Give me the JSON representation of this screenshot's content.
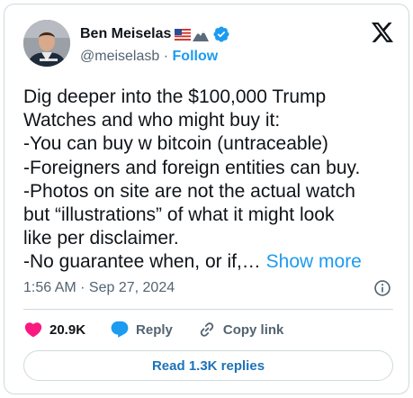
{
  "author": {
    "name": "Ben Meiselas",
    "handle": "@meiselasb",
    "separator": "·",
    "follow_label": "Follow",
    "badge_emojis": [
      "us-flag-emoji",
      "mountain-emoji"
    ],
    "verified": true
  },
  "tweet": {
    "lines": [
      "Dig deeper into the $100,000 Trump",
      "Watches and who might buy it:",
      "-You can buy w bitcoin (untraceable)",
      "-Foreigners and foreign entities can buy.",
      "-Photos on site are not the actual watch",
      "but “illustrations” of what it might look",
      "like per disclaimer.",
      "-No guarantee when, or if,…"
    ],
    "show_more_label": "Show more",
    "timestamp": "1:56 AM · Sep 27, 2024"
  },
  "actions": {
    "likes": "20.9K",
    "reply_label": "Reply",
    "copy_link_label": "Copy link"
  },
  "replies_button_label": "Read 1.3K replies",
  "colors": {
    "accent": "#1d9bf0",
    "like": "#f91880",
    "text": "#0f1419",
    "muted": "#536471",
    "border": "#cfd9de"
  },
  "icons": [
    "avatar-photo",
    "us-flag-emoji",
    "mountain-emoji",
    "verified-badge-icon",
    "x-logo-icon",
    "info-icon",
    "heart-icon",
    "reply-bubble-icon",
    "link-icon"
  ]
}
